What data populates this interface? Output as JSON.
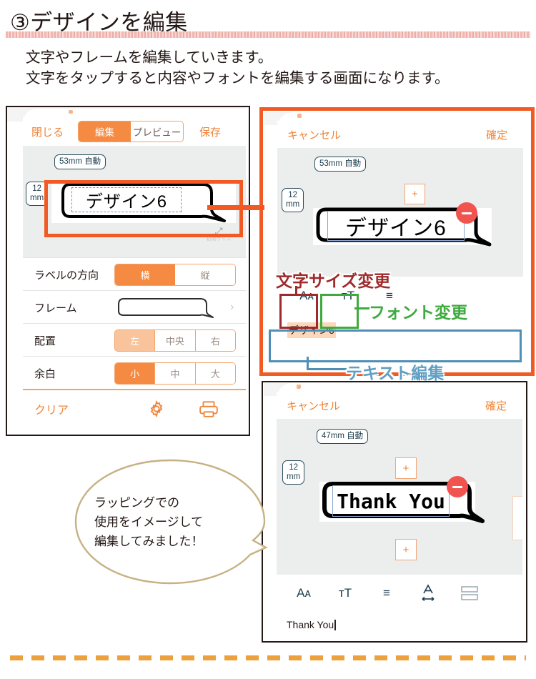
{
  "header": {
    "title": "③デザインを編集",
    "lead_line1": "文字やフレームを編集していきます。",
    "lead_line2": "文字をタップすると内容やフォントを編集する画面になります。"
  },
  "colors": {
    "accent_orange": "#f58a42",
    "annotation_orange": "#f15a22",
    "annotation_red": "#9e2a2b",
    "annotation_green": "#3faa3f",
    "annotation_blue": "#4f8fb5",
    "minus_red": "#f1544f",
    "badge_navy": "#1d3d4d",
    "balloon_gold": "#c6b183",
    "rule_pink": "#f0b3ae",
    "dash_orange": "#eda13c"
  },
  "phone_edit": {
    "nav": {
      "close_label": "閉じる",
      "save_label": "保存",
      "segments": [
        {
          "label": "編集",
          "active": true
        },
        {
          "label": "プレビュー",
          "active": false
        }
      ]
    },
    "canvas": {
      "width_badge": "53mm 自動",
      "height_badge_value": "12",
      "height_badge_unit": "mm",
      "label_text": "デザイン6",
      "resize_hint": "初期サイズ"
    },
    "settings": [
      {
        "label": "ラベルの方向",
        "type": "segmented",
        "options": [
          {
            "label": "横",
            "active": true
          },
          {
            "label": "縦",
            "active": false
          }
        ]
      },
      {
        "label": "フレーム",
        "type": "preview",
        "chevron": "›"
      },
      {
        "label": "配置",
        "type": "segmented",
        "options": [
          {
            "label": "左",
            "active": "pale"
          },
          {
            "label": "中央",
            "active": false
          },
          {
            "label": "右",
            "active": false
          }
        ]
      },
      {
        "label": "余白",
        "type": "segmented",
        "options": [
          {
            "label": "小",
            "active": true
          },
          {
            "label": "中",
            "active": false
          },
          {
            "label": "大",
            "active": false
          }
        ]
      }
    ],
    "footer": {
      "clear_label": "クリア",
      "gear_icon": "gear-icon",
      "print_icon": "printer-icon"
    }
  },
  "phone_text_edit": {
    "nav": {
      "cancel_label": "キャンセル",
      "confirm_label": "確定"
    },
    "canvas": {
      "width_badge": "53mm 自動",
      "height_badge_value": "12",
      "height_badge_unit": "mm",
      "add_button": "+",
      "label_text": "デザイン6",
      "remove_button": "−"
    },
    "toolbar": [
      {
        "icon": "font-size-icon",
        "glyph": "Aᴀ"
      },
      {
        "icon": "font-family-icon",
        "glyph": "ᴛT"
      },
      {
        "icon": "align-icon",
        "glyph": "≡"
      }
    ],
    "text_field": {
      "value": "デザイン6",
      "selected": true
    }
  },
  "phone_thankyou": {
    "nav": {
      "cancel_label": "キャンセル",
      "confirm_label": "確定"
    },
    "canvas": {
      "width_badge": "47mm 自動",
      "height_badge_value": "12",
      "height_badge_unit": "mm",
      "add_button_top": "+",
      "add_button_bottom": "+",
      "label_text": "Thank You",
      "remove_button": "−"
    },
    "toolbar": [
      {
        "icon": "font-size-icon",
        "glyph": "Aᴀ"
      },
      {
        "icon": "font-family-icon",
        "glyph": "ᴛT"
      },
      {
        "icon": "align-icon",
        "glyph": "≡"
      },
      {
        "icon": "letter-spacing-icon",
        "glyph": "A"
      },
      {
        "icon": "split-box-icon",
        "glyph": "▤"
      }
    ],
    "text_field": {
      "value": "Thank You"
    }
  },
  "annotations": {
    "font_size_label": "文字サイズ変更",
    "font_change_label": "フォント変更",
    "text_edit_label": "テキスト編集"
  },
  "callout": {
    "line1": "ラッピングでの",
    "line2": "使用をイメージして",
    "line3": "編集してみました！"
  }
}
